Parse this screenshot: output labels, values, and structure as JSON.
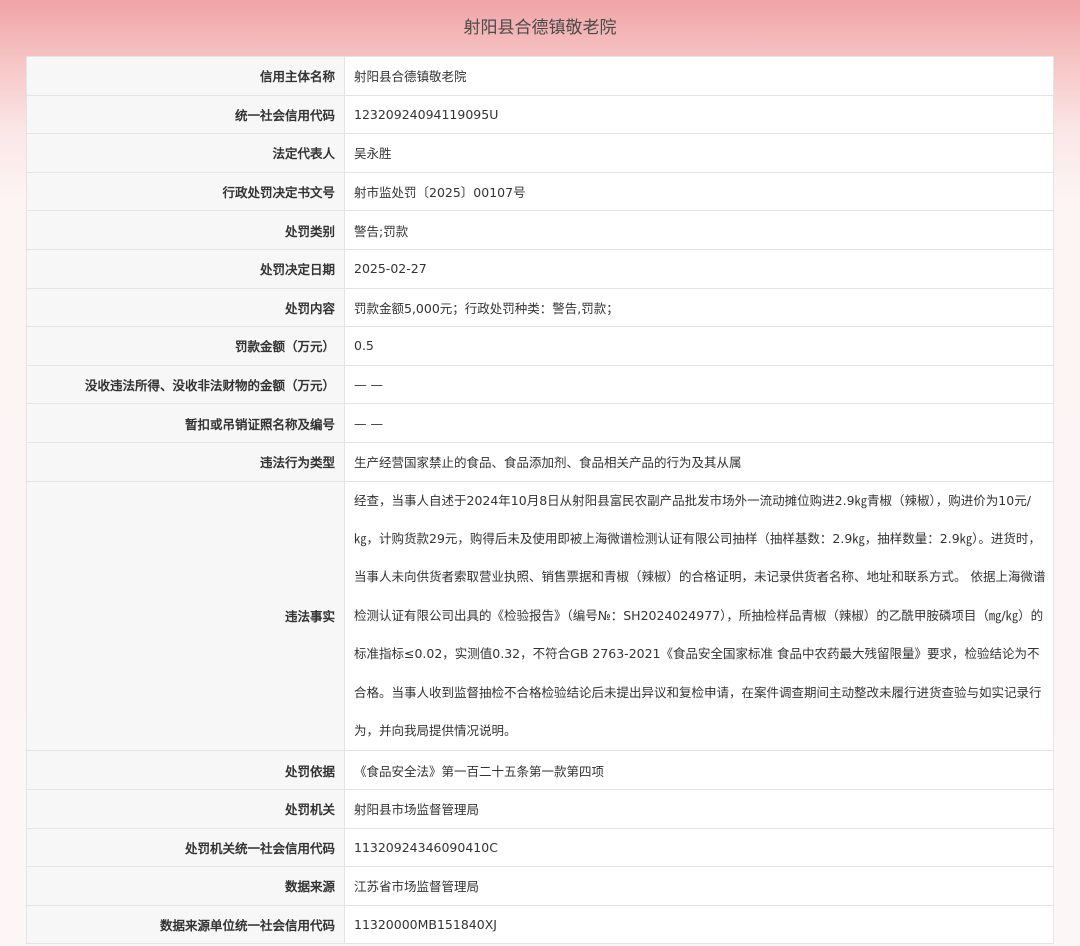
{
  "page_title": "射阳县合德镇敬老院",
  "rows": [
    {
      "label": "信用主体名称",
      "value": "射阳县合德镇敬老院"
    },
    {
      "label": "统一社会信用代码",
      "value": "12320924094119095U"
    },
    {
      "label": "法定代表人",
      "value": "吴永胜"
    },
    {
      "label": "行政处罚决定书文号",
      "value": "射市监处罚〔2025〕00107号"
    },
    {
      "label": "处罚类别",
      "value": "警告;罚款"
    },
    {
      "label": "处罚决定日期",
      "value": "2025-02-27"
    },
    {
      "label": "处罚内容",
      "value": "罚款金额5,000元；行政处罚种类：警告,罚款；"
    },
    {
      "label": "罚款金额（万元）",
      "value": "0.5"
    },
    {
      "label": "没收违法所得、没收非法财物的金额（万元）",
      "value": "— —"
    },
    {
      "label": "暂扣或吊销证照名称及编号",
      "value": "— —"
    },
    {
      "label": "违法行为类型",
      "value": "生产经营国家禁止的食品、食品添加剂、食品相关产品的行为及其从属"
    },
    {
      "label": "违法事实",
      "value": "经查，当事人自述于2024年10月8日从射阳县富民农副产品批发市场外一流动摊位购进2.9㎏青椒（辣椒），购进价为10元/㎏，计购货款29元，购得后未及使用即被上海微谱检测认证有限公司抽样（抽样基数：2.9㎏，抽样数量：2.9㎏）。进货时，当事人未向供货者索取营业执照、销售票据和青椒（辣椒）的合格证明，未记录供货者名称、地址和联系方式。 依据上海微谱检测认证有限公司出具的《检验报告》（编号№：SH2024024977），所抽检样品青椒（辣椒）的乙酰甲胺磷项目（㎎/㎏）的标准指标≤0.02，实测值0.32，不符合GB 2763-2021《食品安全国家标准 食品中农药最大残留限量》要求，检验结论为不合格。当事人收到监督抽检不合格检验结论后未提出异议和复检申请，在案件调查期间主动整改未履行进货查验与如实记录行为，并向我局提供情况说明。"
    },
    {
      "label": "处罚依据",
      "value": "《食品安全法》第一百二十五条第一款第四项"
    },
    {
      "label": "处罚机关",
      "value": "射阳县市场监督管理局"
    },
    {
      "label": "处罚机关统一社会信用代码",
      "value": "11320924346090410C"
    },
    {
      "label": "数据来源",
      "value": "江苏省市场监督管理局"
    },
    {
      "label": "数据来源单位统一社会信用代码",
      "value": "11320000MB151840XJ"
    }
  ]
}
